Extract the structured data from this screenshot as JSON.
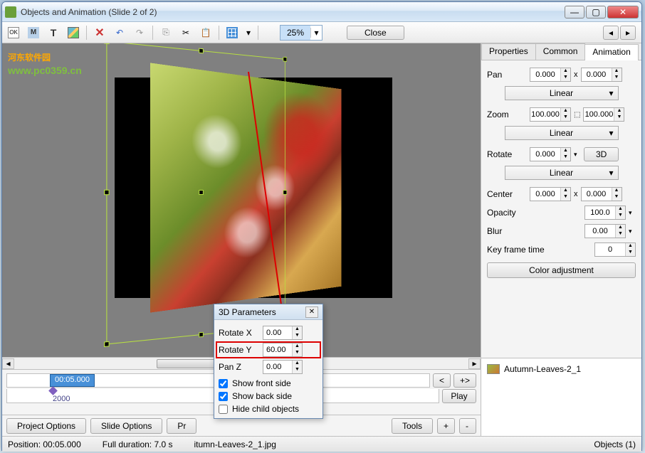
{
  "window": {
    "title": "Objects and Animation  (Slide 2 of 2)"
  },
  "watermark": {
    "main": "河东软件园",
    "sub": "www.pc0359.cn"
  },
  "toolbar": {
    "zoom": "25%",
    "close": "Close"
  },
  "tabs": {
    "properties": "Properties",
    "common": "Common",
    "animation": "Animation"
  },
  "panel": {
    "pan": {
      "label": "Pan",
      "x": "0.000",
      "y": "0.000",
      "linear": "Linear"
    },
    "zoom": {
      "label": "Zoom",
      "x": "100.000",
      "y": "100.000",
      "linear": "Linear"
    },
    "rotate": {
      "label": "Rotate",
      "val": "0.000",
      "btn3d": "3D",
      "linear": "Linear"
    },
    "center": {
      "label": "Center",
      "x": "0.000",
      "y": "0.000"
    },
    "opacity": {
      "label": "Opacity",
      "val": "100.0"
    },
    "blur": {
      "label": "Blur",
      "val": "0.00"
    },
    "keyframe": {
      "label": "Key frame time",
      "val": "0"
    },
    "coloradj": "Color adjustment",
    "x": "x"
  },
  "objlist": {
    "item": "Autumn-Leaves-2_1"
  },
  "timeline": {
    "kf": "00:05.000",
    "dur": "2000",
    "prev": "<",
    "next": "+>",
    "play": "Play"
  },
  "bottom": {
    "project": "Project Options",
    "slide": "Slide Options",
    "pr": "Pr",
    "tools": "Tools",
    "plus": "+",
    "minus": "-"
  },
  "status": {
    "position": "Position:  00:05.000",
    "duration": "Full duration:  7.0 s",
    "file": "itumn-Leaves-2_1.jpg",
    "objects": "Objects (1)"
  },
  "dialog": {
    "title": "3D Parameters",
    "rotx": {
      "label": "Rotate X",
      "val": "0.00"
    },
    "roty": {
      "label": "Rotate Y",
      "val": "60.00"
    },
    "panz": {
      "label": "Pan Z",
      "val": "0.00"
    },
    "showfront": "Show front side",
    "showback": "Show back side",
    "hidechild": "Hide child objects"
  }
}
